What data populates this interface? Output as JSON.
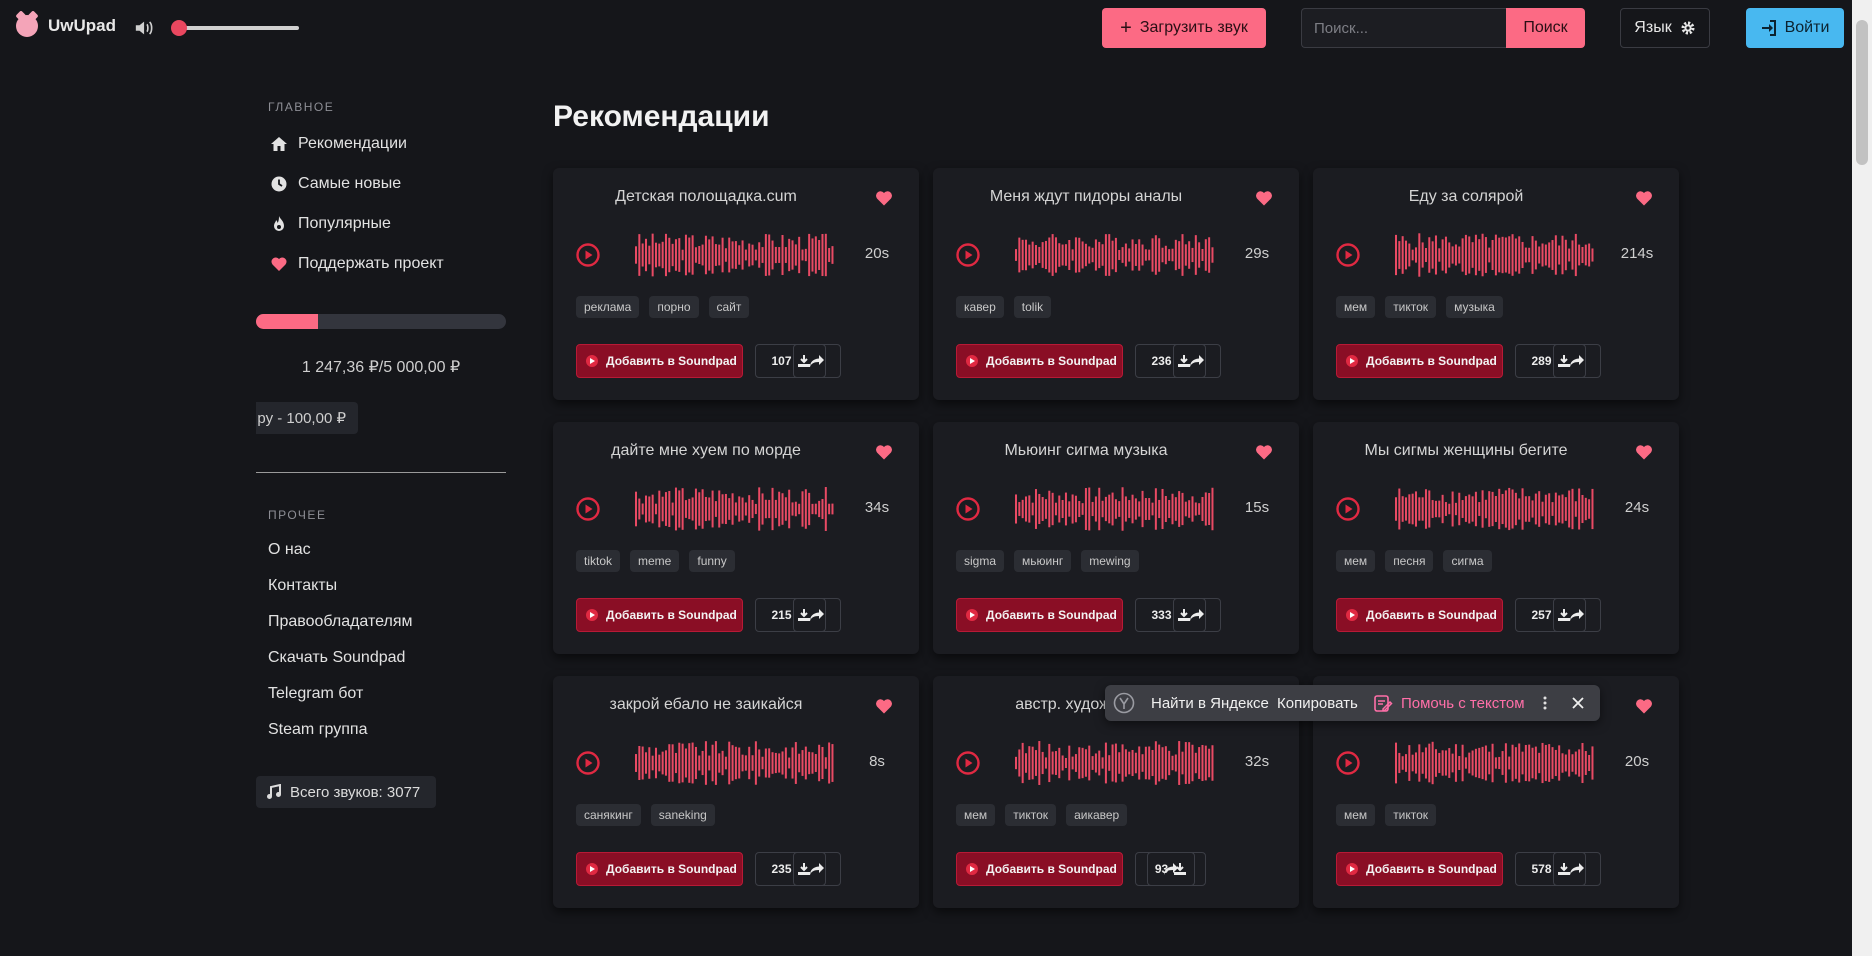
{
  "header": {
    "logo_text": "UwUpad",
    "volume_level": 0.05,
    "upload_label": "Загрузить звук",
    "search_placeholder": "Поиск...",
    "search_button": "Поиск",
    "lang_label": "Язык",
    "login_label": "Войти"
  },
  "sidebar": {
    "main_title": "ГЛАВНОЕ",
    "main_items": [
      {
        "label": "Рекомендации",
        "icon": "home-icon"
      },
      {
        "label": "Самые новые",
        "icon": "clock-icon"
      },
      {
        "label": "Популярные",
        "icon": "fire-icon"
      },
      {
        "label": "Поддержать проект",
        "icon": "heart-icon"
      }
    ],
    "donation_progress": 0.2494,
    "donation_amount": "1 247,36 ₽/5 000,00 ₽",
    "donor_text": "ру - 100,00 ₽",
    "other_title": "ПРОЧЕЕ",
    "other_links": [
      "О нас",
      "Контакты",
      "Правообладателям",
      "Скачать Soundpad",
      "Telegram бот",
      "Steam группа"
    ],
    "total_sounds": "Всего звуков: 3077"
  },
  "main": {
    "title": "Рекомендации",
    "add_label": "Добавить в Soundpad",
    "cards": [
      {
        "title": "Детская полощадка.cum",
        "duration": "20s",
        "tags": [
          "реклама",
          "порно",
          "сайт"
        ],
        "downloads": "107"
      },
      {
        "title": "Меня ждут пидоры аналы",
        "duration": "29s",
        "tags": [
          "кавер",
          "tolik"
        ],
        "downloads": "236"
      },
      {
        "title": "Еду за солярой",
        "duration": "214s",
        "tags": [
          "мем",
          "тикток",
          "музыка"
        ],
        "downloads": "289"
      },
      {
        "title": "дайте мне хуем по морде",
        "duration": "34s",
        "tags": [
          "tiktok",
          "meme",
          "funny"
        ],
        "downloads": "215"
      },
      {
        "title": "Мьюинг сигма музыка",
        "duration": "15s",
        "tags": [
          "sigma",
          "мьюинг",
          "mewing"
        ],
        "downloads": "333"
      },
      {
        "title": "Мы сигмы женщины бегите",
        "duration": "24s",
        "tags": [
          "мем",
          "песня",
          "сигма"
        ],
        "downloads": "257"
      },
      {
        "title": "закрой ебало не заикайся",
        "duration": "8s",
        "tags": [
          "санякинг",
          "saneking"
        ],
        "downloads": "235"
      },
      {
        "title": "австр. художник - х",
        "duration": "32s",
        "tags": [
          "мем",
          "тикток",
          "аикавер"
        ],
        "downloads": "93"
      },
      {
        "title": "",
        "duration": "20s",
        "tags": [
          "мем",
          "тикток"
        ],
        "downloads": "578"
      }
    ]
  },
  "popup": {
    "find_label": "Найти в Яндексе",
    "copy_label": "Копировать",
    "help_label": "Помочь с текстом"
  },
  "colors": {
    "accent_pink": "#fc6a84",
    "wave_red": "#e94a64",
    "login_blue": "#48b8f0",
    "add_button_red": "#8a0e25"
  }
}
